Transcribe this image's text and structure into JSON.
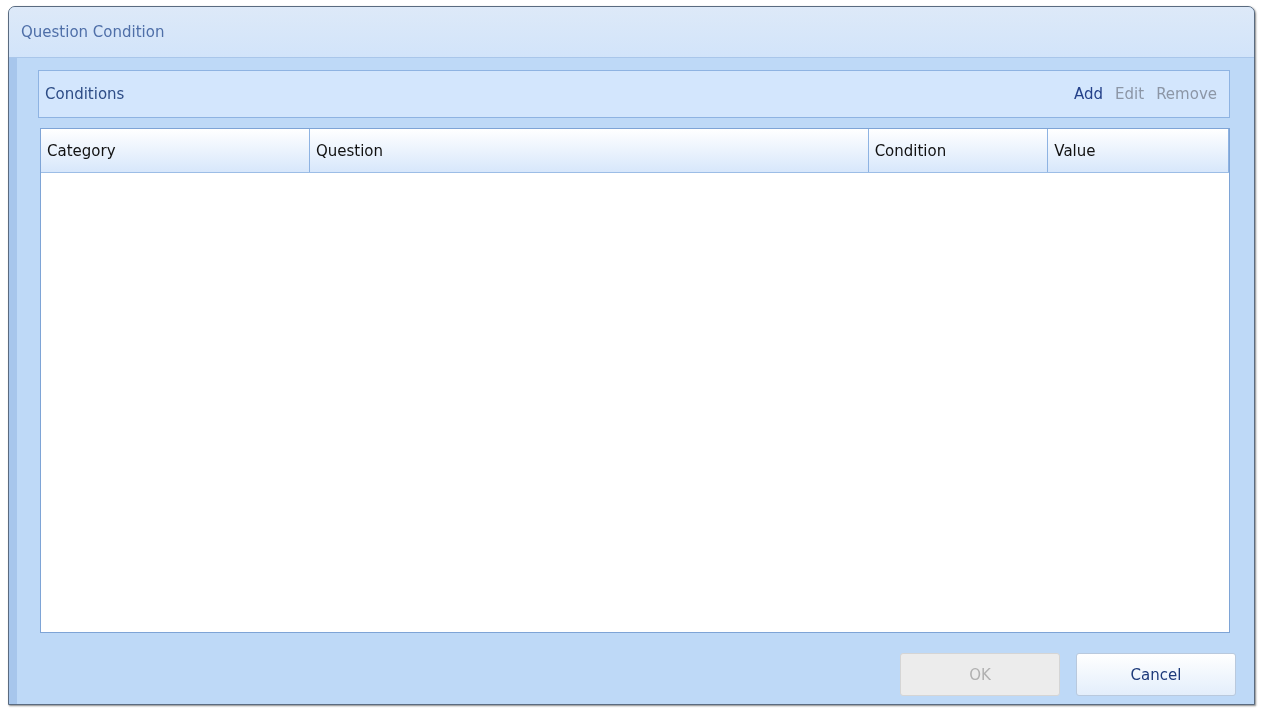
{
  "window": {
    "title": "Question Condition"
  },
  "conditions": {
    "title": "Conditions",
    "actions": [
      {
        "label": "Add",
        "disabled": false
      },
      {
        "label": "Edit",
        "disabled": true
      },
      {
        "label": "Remove",
        "disabled": true
      }
    ]
  },
  "table": {
    "columns": [
      "Category",
      "Question",
      "Condition",
      "Value"
    ]
  },
  "buttons": [
    {
      "label": "OK",
      "disabled": true
    },
    {
      "label": "Cancel",
      "disabled": false
    }
  ]
}
